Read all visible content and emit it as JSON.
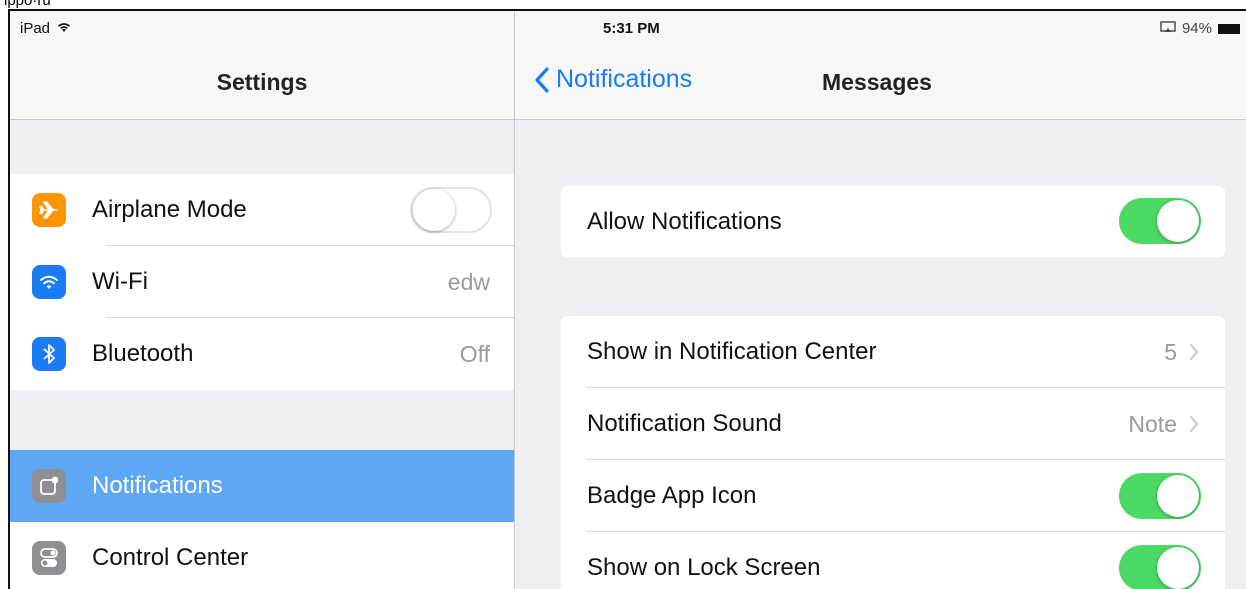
{
  "status_bar": {
    "device": "iPad",
    "time": "5:31 PM",
    "battery": "94%"
  },
  "left_nav": {
    "title": "Settings"
  },
  "right_nav": {
    "back_label": "Notifications",
    "title": "Messages"
  },
  "settings_list": {
    "group1": [
      {
        "label": "Airplane Mode",
        "icon": "airplane-icon",
        "icon_color": "#ff9500",
        "control": "toggle",
        "state": "off"
      },
      {
        "label": "Wi-Fi",
        "icon": "wifi-icon",
        "icon_color": "#1a7cf5",
        "value": "edw"
      },
      {
        "label": "Bluetooth",
        "icon": "bluetooth-icon",
        "icon_color": "#1a7cf5",
        "value": "Off"
      }
    ],
    "group2": [
      {
        "label": "Notifications",
        "icon": "notifications-icon",
        "icon_color": "#8e8e93",
        "selected": true
      },
      {
        "label": "Control Center",
        "icon": "control-center-icon",
        "icon_color": "#8e8e93"
      }
    ]
  },
  "messages_settings": {
    "allow": {
      "label": "Allow Notifications",
      "state": "on"
    },
    "rows": [
      {
        "label": "Show in Notification Center",
        "value": "5",
        "type": "disclosure"
      },
      {
        "label": "Notification Sound",
        "value": "Note",
        "type": "disclosure"
      },
      {
        "label": "Badge App Icon",
        "state": "on",
        "type": "toggle"
      },
      {
        "label": "Show on Lock Screen",
        "state": "on",
        "type": "toggle"
      }
    ]
  },
  "colors": {
    "accent": "#1a7cf5",
    "toggle_on": "#4cd964",
    "selected_row": "#5ea7f4"
  }
}
